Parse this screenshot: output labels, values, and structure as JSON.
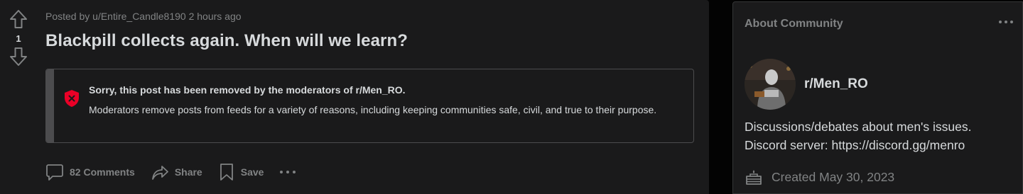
{
  "post": {
    "meta": {
      "prefix": "Posted by",
      "author": "u/Entire_Candle8190",
      "time": "2 hours ago"
    },
    "votes": "1",
    "title": "Blackpill collects again. When will we learn?",
    "removed_notice": {
      "title": "Sorry, this post has been removed by the moderators of r/Men_RO.",
      "text": "Moderators remove posts from feeds for a variety of reasons, including keeping communities safe, civil, and true to their purpose."
    },
    "actions": {
      "comments": "82 Comments",
      "share": "Share",
      "save": "Save"
    }
  },
  "sidebar": {
    "heading": "About Community",
    "community_name": "r/Men_RO",
    "description_lines": [
      "Discussions/debates about men's issues.",
      "Discord server: https://discord.gg/menro"
    ],
    "created": "Created May 30, 2023"
  },
  "colors": {
    "background": "#030303",
    "card": "#1a1a1b",
    "text": "#d7dadc",
    "muted": "#818384",
    "border": "#343536",
    "removed_accent": "#4c4c4e",
    "shield_red": "#ea0027"
  },
  "icons": {
    "upvote": "arrow-up-icon",
    "downvote": "arrow-down-icon",
    "removed": "shield-x-icon",
    "comments": "comment-bubble-icon",
    "share": "share-arrow-icon",
    "save": "bookmark-icon",
    "more": "more-dots-icon",
    "created": "cake-icon"
  }
}
